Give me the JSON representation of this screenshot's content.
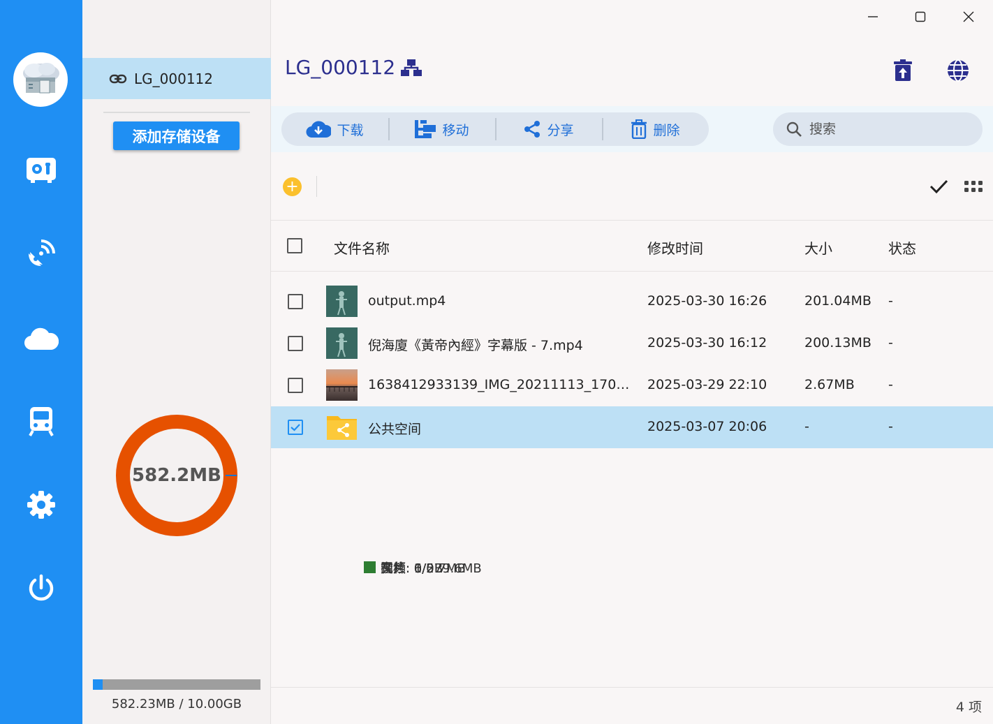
{
  "device": {
    "name": "LG_000112"
  },
  "side": {
    "add_button": "添加存储设备",
    "donut_label": "582.2MB",
    "legend": [
      {
        "text": "视频: 6/579.6MB",
        "color": "#e65100"
      },
      {
        "text": "图片: 1/2.7MB",
        "color": "#1976d2"
      },
      {
        "text": "音频: 0/0B",
        "color": "#fbc02d"
      },
      {
        "text": "文档: 0/0B",
        "color": "#2e7d32"
      }
    ],
    "usage": {
      "used_fraction": 0.057,
      "text": "582.23MB / 10.00GB"
    }
  },
  "header": {
    "title": "LG_000112"
  },
  "toolbar": {
    "download": "下载",
    "move": "移动",
    "share": "分享",
    "delete": "删除",
    "search_placeholder": "搜索"
  },
  "table": {
    "columns": {
      "name": "文件名称",
      "time": "修改时间",
      "size": "大小",
      "status": "状态"
    },
    "rows": [
      {
        "name": "output.mp4",
        "time": "2025-03-30 16:26",
        "size": "201.04MB",
        "status": "-",
        "checked": false
      },
      {
        "name": "倪海廈《黃帝內經》字幕版 - 7.mp4",
        "time": "2025-03-30 16:12",
        "size": "200.13MB",
        "status": "-",
        "checked": false
      },
      {
        "name": "1638412933139_IMG_20211113_1708...",
        "time": "2025-03-29 22:10",
        "size": "2.67MB",
        "status": "-",
        "checked": false
      },
      {
        "name": "公共空间",
        "time": "2025-03-07 20:06",
        "size": "-",
        "status": "-",
        "checked": true
      }
    ]
  },
  "footer": {
    "count": "4 项"
  },
  "colors": {
    "accent": "#1f8ff3",
    "selected_row": "#bde0f5",
    "donut": "#e65100",
    "title": "#2c2f8e"
  }
}
